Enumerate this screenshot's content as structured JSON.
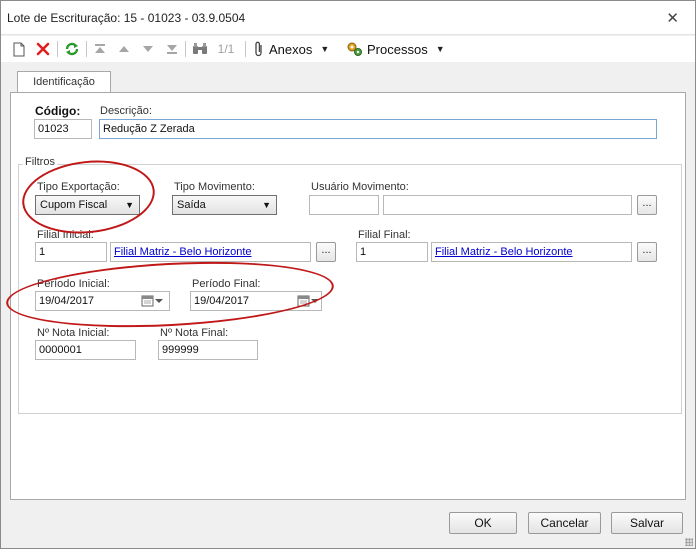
{
  "window": {
    "title": "Lote de Escrituração: 15 - 01023 - 03.9.0504",
    "close_glyph": "✕"
  },
  "toolbar": {
    "page_counter": "1/1",
    "anexos_label": "Anexos",
    "processos_label": "Processos"
  },
  "tabs": [
    {
      "label": "Identificação",
      "active": true
    }
  ],
  "form": {
    "codigo_label": "Código:",
    "codigo_value": "01023",
    "descricao_label": "Descrição:",
    "descricao_value": "Redução Z Zerada",
    "filtros_label": "Filtros",
    "tipo_exportacao_label": "Tipo Exportação:",
    "tipo_exportacao_value": "Cupom Fiscal",
    "tipo_movimento_label": "Tipo Movimento:",
    "tipo_movimento_value": "Saída",
    "usuario_movimento_label": "Usuário Movimento:",
    "usuario_movimento_code": "",
    "usuario_movimento_name": "",
    "filial_inicial_label": "Filial Inicial:",
    "filial_inicial_code": "1",
    "filial_inicial_name": "Filial Matriz - Belo Horizonte",
    "filial_final_label": "Filial Final:",
    "filial_final_code": "1",
    "filial_final_name": "Filial Matriz - Belo Horizonte",
    "periodo_inicial_label": "Período Inicial:",
    "periodo_inicial_value": "19/04/2017",
    "periodo_final_label": "Período Final:",
    "periodo_final_value": "19/04/2017",
    "nota_inicial_label": "Nº Nota Inicial:",
    "nota_inicial_value": "0000001",
    "nota_final_label": "Nº Nota Final:",
    "nota_final_value": "999999",
    "ellipsis_label": "..."
  },
  "buttons": {
    "ok": "OK",
    "cancelar": "Cancelar",
    "salvar": "Salvar"
  },
  "icons": {
    "new": "new-document-icon",
    "delete": "delete-x-icon",
    "refresh": "refresh-icon",
    "first": "first-record-icon",
    "prev": "previous-record-icon",
    "next": "next-record-icon",
    "last": "last-record-icon",
    "find": "binoculars-icon",
    "anexos": "paperclip-icon",
    "processos": "gears-icon",
    "calendar": "calendar-icon"
  },
  "colors": {
    "annotation_red": "#c01818",
    "link_blue": "#0000cc",
    "delete_red": "#e02020",
    "refresh_green": "#2a9a2a"
  }
}
